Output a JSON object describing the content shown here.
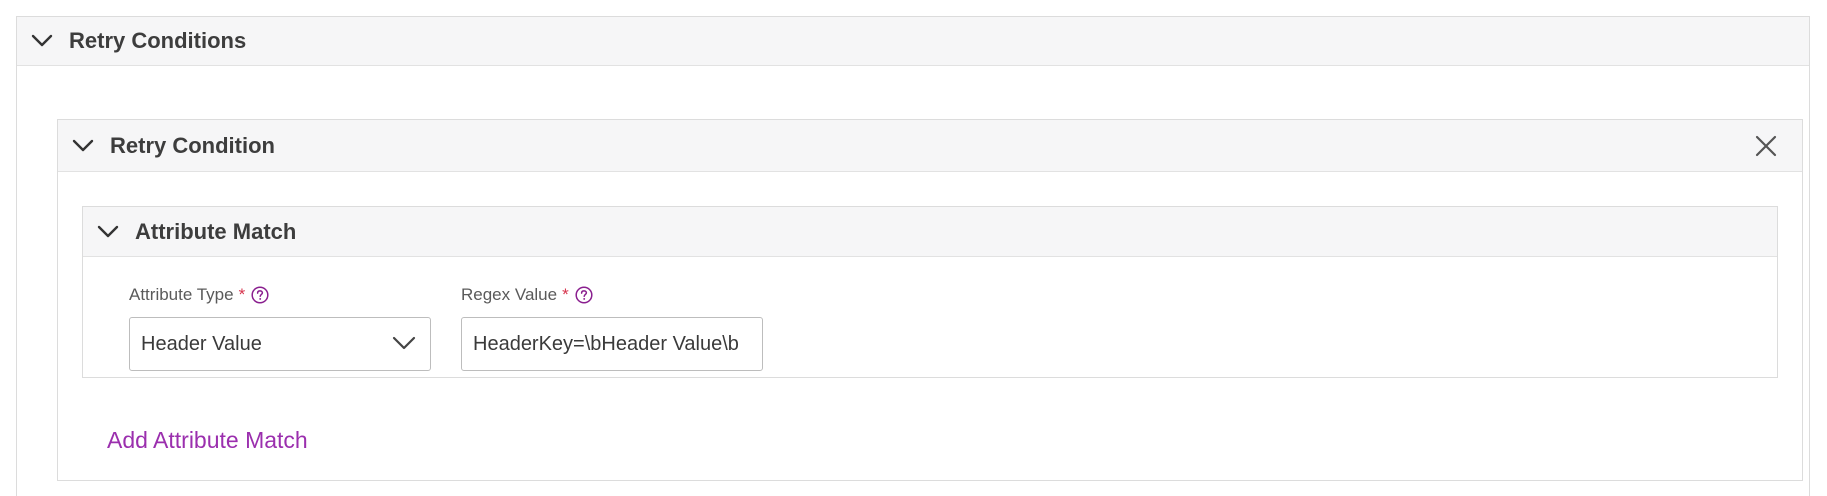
{
  "retry_conditions": {
    "title": "Retry Conditions",
    "condition": {
      "title": "Retry Condition",
      "attribute_match": {
        "title": "Attribute Match",
        "attribute_type": {
          "label": "Attribute Type",
          "required_marker": "*",
          "value": "Header Value"
        },
        "regex_value": {
          "label": "Regex Value",
          "required_marker": "*",
          "value": "HeaderKey=\\bHeader Value\\b"
        }
      },
      "add_attribute_match_label": "Add Attribute Match"
    }
  },
  "icons": {
    "collapse": "chevron-down-icon",
    "close": "close-icon",
    "help": "help-circle-icon",
    "select": "chevron-down-icon"
  },
  "colors": {
    "accent": "#9b2fae",
    "required": "#d6334c",
    "header_bg": "#f6f6f7",
    "border": "#dcdcdc"
  }
}
